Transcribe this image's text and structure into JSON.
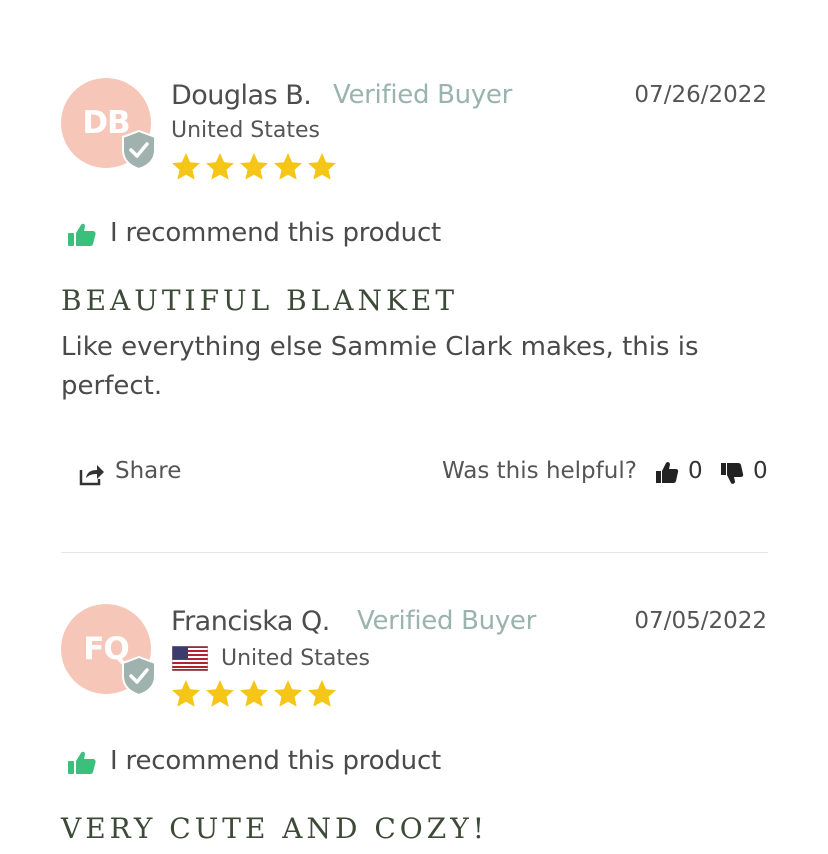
{
  "reviews": [
    {
      "initials": "DB",
      "name": "Douglas B.",
      "verified": "Verified Buyer",
      "date": "07/26/2022",
      "location": "United States",
      "rating": 5,
      "recommend": "I recommend this product",
      "title": "BEAUTIFUL BLANKET",
      "body": "Like everything else Sammie Clark makes, this is perfect.",
      "share_label": "Share",
      "helpful_label": "Was this helpful?",
      "helpful_up": "0",
      "helpful_down": "0"
    },
    {
      "initials": "FQ",
      "name": "Franciska Q.",
      "verified": "Verified Buyer",
      "date": "07/05/2022",
      "location": "United States",
      "flag_icon": "us-flag-icon",
      "rating": 5,
      "recommend": "I recommend this product",
      "title": "VERY CUTE AND COZY!"
    }
  ],
  "colors": {
    "avatar_bg": "#f6c6b8",
    "badge": "#9fb2ad",
    "verified_text": "#9ab3ae",
    "star": "#f5c518",
    "recommend_thumb": "#3bbf7a",
    "title_text": "#3d4a38"
  }
}
